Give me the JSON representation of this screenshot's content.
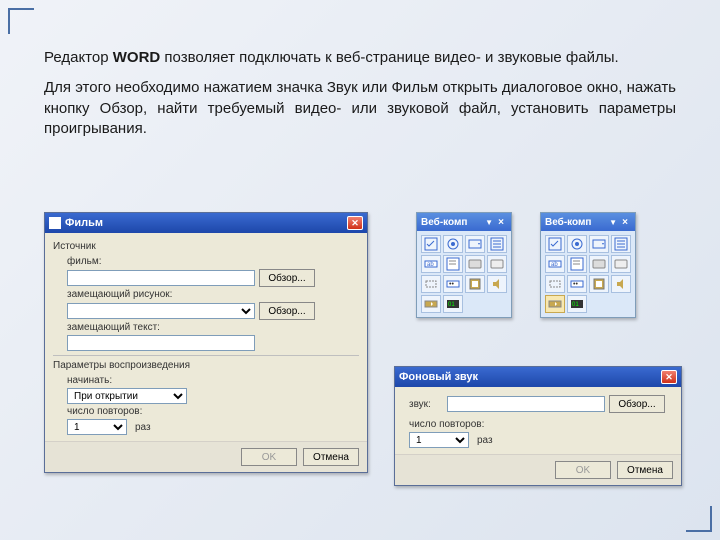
{
  "intro": {
    "p1_a": "Редактор ",
    "p1_b": "WORD",
    "p1_c": " позволяет подключать к веб-странице видео- и звуковые файлы.",
    "p2": "Для этого необходимо нажатием значка Звук или Фильм открыть диалоговое окно, нажать кнопку Обзор, найти требуемый видео- или звуковой файл, установить параметры проигрывания."
  },
  "film": {
    "title": "Фильм",
    "group_source": "Источник",
    "lbl_film": "фильм:",
    "val_film": "",
    "lbl_image": "замещающий рисунок:",
    "val_image": "",
    "lbl_text": "замещающий текст:",
    "val_text": "",
    "group_play": "Параметры воспроизведения",
    "lbl_start": "начинать:",
    "opt_start": "При открытии",
    "lbl_repeat": "число повторов:",
    "val_repeat": "1",
    "unit": "раз",
    "browse": "Обзор...",
    "ok": "OK",
    "cancel": "Отмена"
  },
  "sound": {
    "title": "Фоновый звук",
    "lbl_sound": "звук:",
    "val_sound": "",
    "lbl_repeat": "число повторов:",
    "val_repeat": "1",
    "unit": "раз",
    "browse": "Обзор...",
    "ok": "OK",
    "cancel": "Отмена"
  },
  "wc": {
    "title": "Веб-комп",
    "close": "×"
  }
}
